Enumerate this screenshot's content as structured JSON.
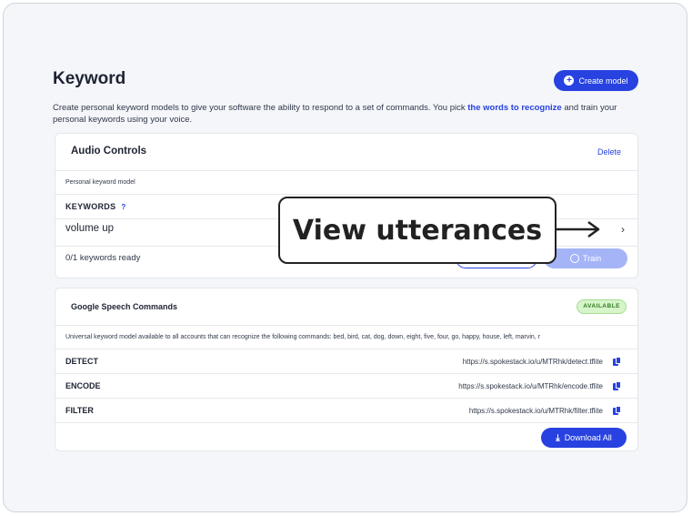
{
  "page": {
    "title": "Keyword",
    "create_label": "Create model",
    "description_pre": "Create personal keyword models to give your software the ability to respond to a set of commands. You pick ",
    "description_link": "the words to recognize",
    "description_post": " and train your personal keywords using your voice."
  },
  "audio_card": {
    "title": "Audio Controls",
    "delete_label": "Delete",
    "subtitle": "Personal keyword model",
    "keywords_label": "KEYWORDS",
    "help": "?",
    "keyword": "volume up",
    "chevron": "›",
    "ready": "0/1 keywords ready",
    "train_label": "Train"
  },
  "speech_card": {
    "title": "Google Speech Commands",
    "badge": "AVAILABLE",
    "description": "Universal keyword model available to all accounts that can recognize the following commands: bed, bird, cat, dog, down, eight, five, four, go, happy, house, left, marvin, r",
    "rows": [
      {
        "label": "DETECT",
        "url": "https://s.spokestack.io/u/MTRhk/detect.tflite"
      },
      {
        "label": "ENCODE",
        "url": "https://s.spokestack.io/u/MTRhk/encode.tflite"
      },
      {
        "label": "FILTER",
        "url": "https://s.spokestack.io/u/MTRhk/filter.tflite"
      }
    ],
    "download_label": "Download All"
  },
  "callout": {
    "text": "View utterances"
  },
  "colors": {
    "accent": "#2742e0",
    "badge_bg": "#d6f5c9",
    "train_disabled": "#a5b4f7"
  },
  "icons": [
    "plus-icon",
    "help-icon",
    "chevron-right-icon",
    "clock-icon",
    "copy-icon",
    "download-icon",
    "arrow-right-icon"
  ]
}
